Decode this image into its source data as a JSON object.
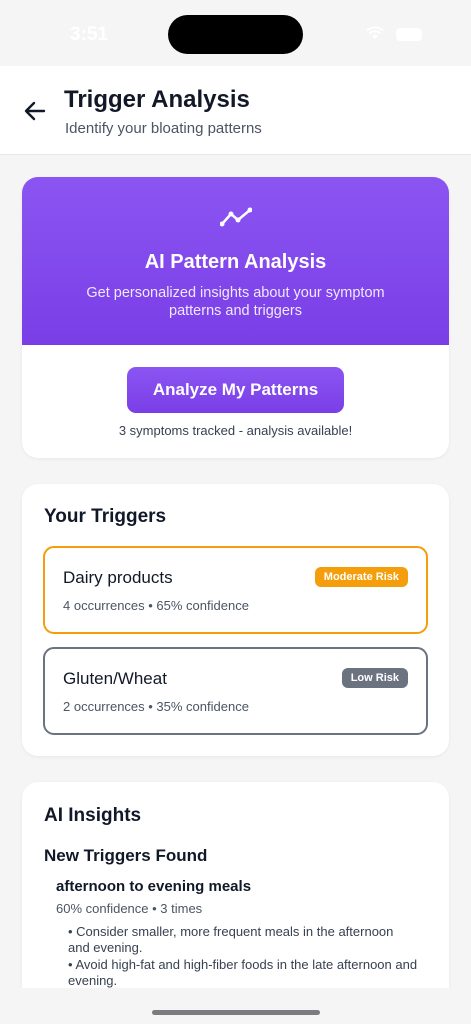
{
  "status_bar": {
    "time": "3:51"
  },
  "header": {
    "title": "Trigger Analysis",
    "subtitle": "Identify your bloating patterns"
  },
  "ai_card": {
    "title": "AI Pattern Analysis",
    "description": "Get personalized insights about your symptom patterns and triggers",
    "button_label": "Analyze My Patterns",
    "note": "3 symptoms tracked - analysis available!"
  },
  "triggers": {
    "title": "Your Triggers",
    "items": [
      {
        "name": "Dairy products",
        "meta": "4 occurrences • 65% confidence",
        "risk": "Moderate Risk",
        "color": "#f59e0b"
      },
      {
        "name": "Gluten/Wheat",
        "meta": "2 occurrences • 35% confidence",
        "risk": "Low Risk",
        "color": "#6b7280"
      }
    ]
  },
  "insights": {
    "title": "AI Insights",
    "subtitle": "New Triggers Found",
    "items": [
      {
        "name": "afternoon to evening meals",
        "meta": "60% confidence • 3 times",
        "bullets": [
          "• Consider smaller, more frequent meals in the afternoon and evening.",
          "• Avoid high-fat and high-fiber foods in the late afternoon and evening."
        ]
      }
    ]
  },
  "colors": {
    "accent": "#7c3aed",
    "moderate": "#f59e0b",
    "low": "#6b7280"
  }
}
